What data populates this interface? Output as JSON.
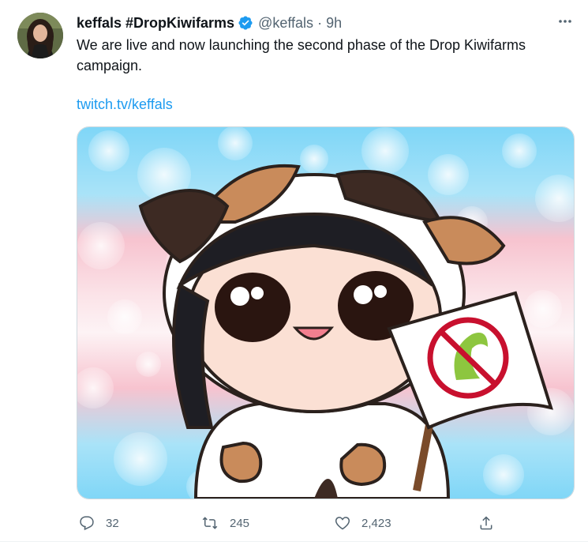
{
  "tweet": {
    "display_name": "keffals #DropKiwifarms",
    "handle": "@keffals",
    "separator": "·",
    "time": "9h",
    "text": "We are live and now launching the second phase of the Drop Kiwifarms campaign.",
    "link": "twitch.tv/keffals",
    "verified": true
  },
  "actions": {
    "reply": {
      "icon": "reply-icon",
      "count": "32"
    },
    "retweet": {
      "icon": "retweet-icon",
      "count": "245"
    },
    "like": {
      "icon": "heart-icon",
      "count": "2,423"
    },
    "share": {
      "icon": "share-icon"
    }
  },
  "media": {
    "description_icon": "cartoon-character-with-sign-image",
    "sign_icon": "no-kiwi-prohibition-icon"
  },
  "colors": {
    "accent": "#1d9bf0",
    "text": "#0f1419",
    "secondary": "#536471",
    "trans_blue": "#5bcefa",
    "trans_pink": "#f5a9b8",
    "prohibit_red": "#c8102e",
    "kiwi_green": "#8dc63f"
  }
}
